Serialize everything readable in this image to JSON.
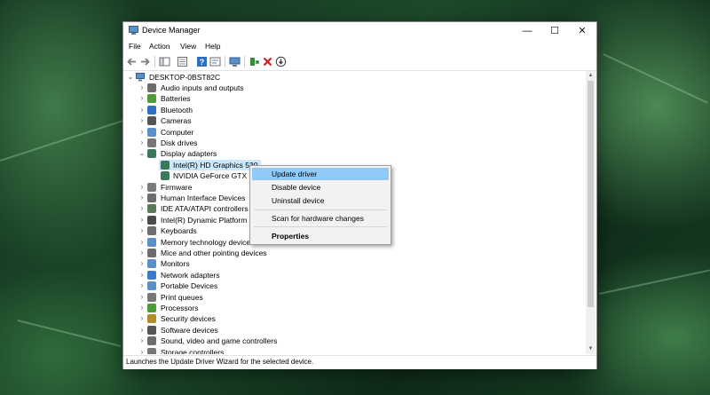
{
  "window": {
    "title": "Device Manager"
  },
  "title_buttons": {
    "minimize": "—",
    "maximize": "☐",
    "close": "✕"
  },
  "menu": {
    "file": "File",
    "action": "Action",
    "view": "View",
    "help": "Help"
  },
  "toolbar_icons": [
    "back-arrow",
    "forward-arrow",
    "show-hide-tree",
    "properties",
    "help",
    "view-resources",
    "scan-monitor",
    "update-driver",
    "uninstall-device",
    "download"
  ],
  "tree": {
    "root": "DESKTOP-0BST82C",
    "categories": [
      {
        "label": "Audio inputs and outputs",
        "icon": "speaker-icon"
      },
      {
        "label": "Batteries",
        "icon": "battery-icon"
      },
      {
        "label": "Bluetooth",
        "icon": "bluetooth-icon"
      },
      {
        "label": "Cameras",
        "icon": "camera-icon"
      },
      {
        "label": "Computer",
        "icon": "computer-icon"
      },
      {
        "label": "Disk drives",
        "icon": "disk-icon"
      },
      {
        "label": "Display adapters",
        "icon": "display-adapter-icon"
      },
      {
        "label": "Firmware",
        "icon": "firmware-icon"
      },
      {
        "label": "Human Interface Devices",
        "icon": "hid-icon"
      },
      {
        "label": "IDE ATA/ATAPI controllers",
        "icon": "ide-icon"
      },
      {
        "label": "Intel(R) Dynamic Platform a",
        "icon": "chip-icon"
      },
      {
        "label": "Keyboards",
        "icon": "keyboard-icon"
      },
      {
        "label": "Memory technology device",
        "icon": "memory-icon"
      },
      {
        "label": "Mice and other pointing devices",
        "icon": "mouse-icon"
      },
      {
        "label": "Monitors",
        "icon": "monitor-icon"
      },
      {
        "label": "Network adapters",
        "icon": "network-icon"
      },
      {
        "label": "Portable Devices",
        "icon": "portable-device-icon"
      },
      {
        "label": "Print queues",
        "icon": "printer-icon"
      },
      {
        "label": "Processors",
        "icon": "processor-icon"
      },
      {
        "label": "Security devices",
        "icon": "security-icon"
      },
      {
        "label": "Software devices",
        "icon": "software-icon"
      },
      {
        "label": "Sound, video and game controllers",
        "icon": "sound-icon"
      },
      {
        "label": "Storage controllers",
        "icon": "storage-icon"
      }
    ],
    "display_adapters_children": [
      {
        "label": "Intel(R) HD Graphics 530"
      },
      {
        "label": "NVIDIA GeForce GTX 960"
      }
    ]
  },
  "context_menu": {
    "update_driver": "Update driver",
    "disable_device": "Disable device",
    "uninstall_device": "Uninstall device",
    "scan": "Scan for hardware changes",
    "properties": "Properties"
  },
  "status": {
    "text": "Launches the Update Driver Wizard for the selected device."
  },
  "colors": {
    "selection": "#cce8ff",
    "menu_highlight": "#91c9f7",
    "accent": "#0078d7"
  }
}
